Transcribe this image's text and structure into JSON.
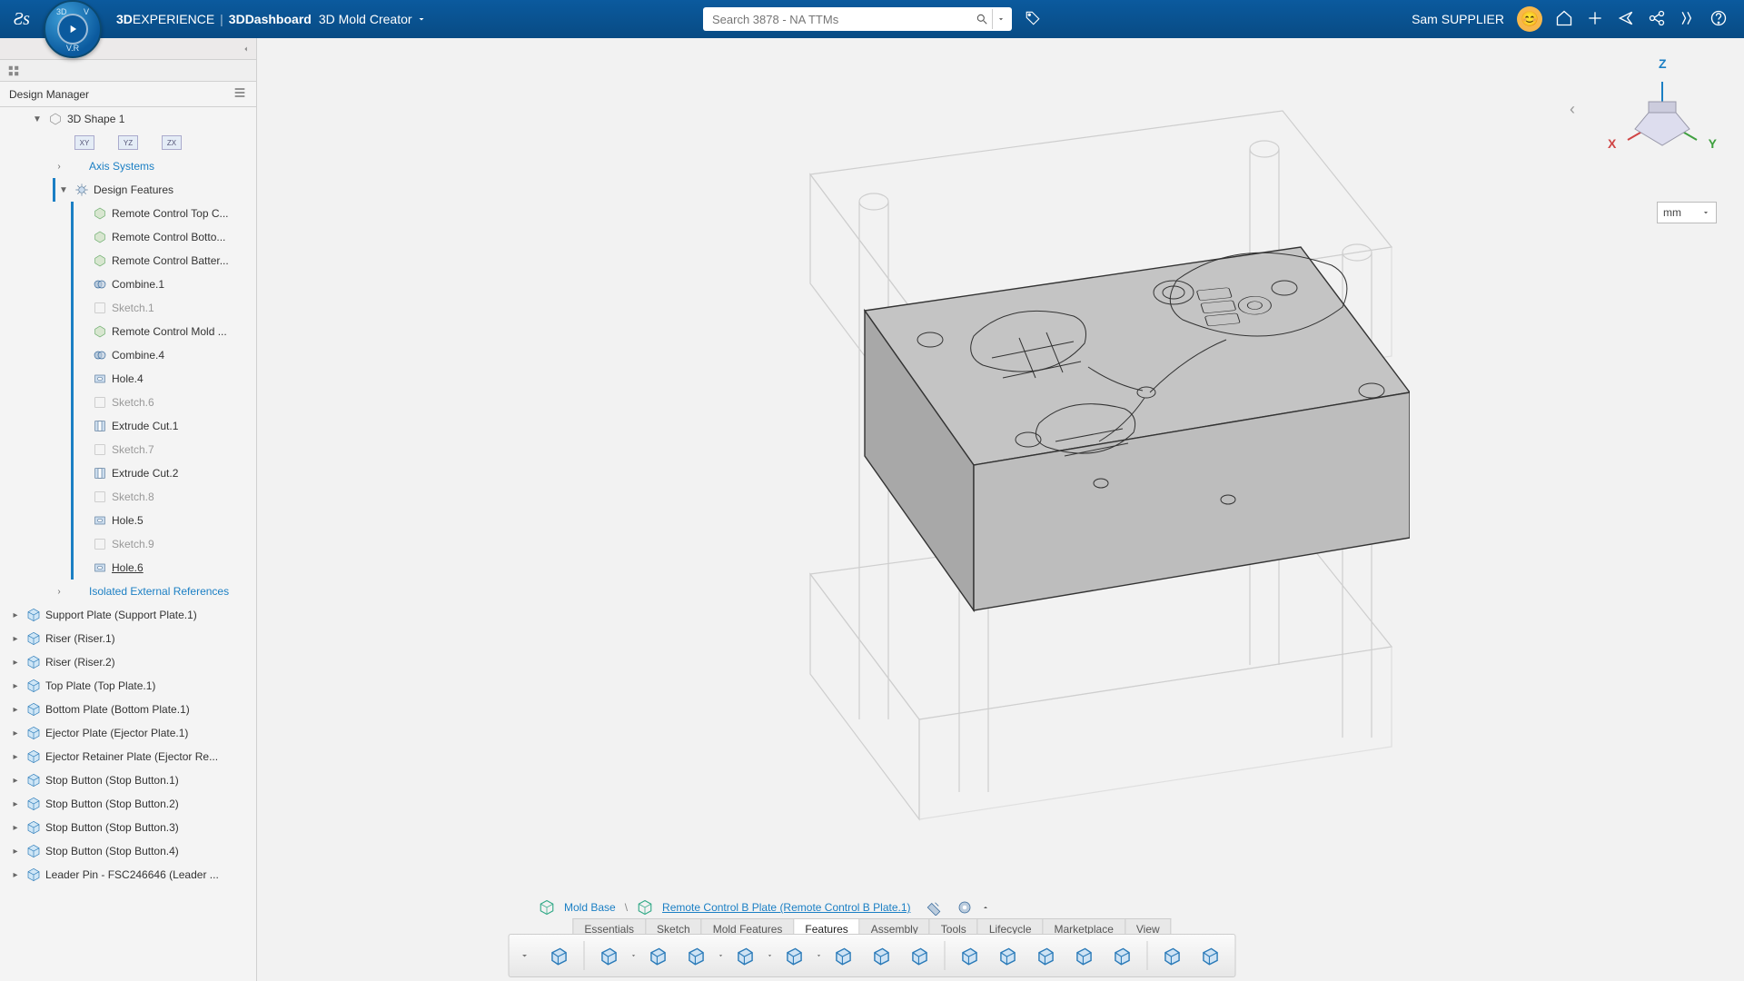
{
  "header": {
    "brand_a": "3D",
    "brand_b": "EXPERIENCE",
    "brand_c": "3DDashboard",
    "app": "3D Mold Creator",
    "search_placeholder": "Search 3878 - NA TTMs",
    "user": "Sam SUPPLIER",
    "avatar_emoji": "😊"
  },
  "panel": {
    "title": "Design Manager",
    "root": "3D Shape 1",
    "axis": "Axis Systems",
    "features_label": "Design Features",
    "features": [
      {
        "label": "Remote Control Top C...",
        "icon": "part",
        "muted": false
      },
      {
        "label": "Remote Control Botto...",
        "icon": "part",
        "muted": false
      },
      {
        "label": "Remote Control Batter...",
        "icon": "part",
        "muted": false
      },
      {
        "label": "Combine.1",
        "icon": "combine",
        "muted": false
      },
      {
        "label": "Sketch.1",
        "icon": "sketch",
        "muted": true
      },
      {
        "label": "Remote Control Mold ...",
        "icon": "part",
        "muted": false
      },
      {
        "label": "Combine.4",
        "icon": "combine",
        "muted": false
      },
      {
        "label": "Hole.4",
        "icon": "hole",
        "muted": false
      },
      {
        "label": "Sketch.6",
        "icon": "sketch",
        "muted": true
      },
      {
        "label": "Extrude Cut.1",
        "icon": "cut",
        "muted": false
      },
      {
        "label": "Sketch.7",
        "icon": "sketch",
        "muted": true
      },
      {
        "label": "Extrude Cut.2",
        "icon": "cut",
        "muted": false
      },
      {
        "label": "Sketch.8",
        "icon": "sketch",
        "muted": true
      },
      {
        "label": "Hole.5",
        "icon": "hole",
        "muted": false
      },
      {
        "label": "Sketch.9",
        "icon": "sketch",
        "muted": true
      },
      {
        "label": "Hole.6",
        "icon": "hole",
        "muted": false,
        "current": true
      }
    ],
    "iso_refs": "Isolated External References",
    "assembly": [
      "Support Plate (Support Plate.1)",
      "Riser (Riser.1)",
      "Riser (Riser.2)",
      "Top Plate (Top Plate.1)",
      "Bottom Plate (Bottom Plate.1)",
      "Ejector Plate (Ejector Plate.1)",
      "Ejector Retainer Plate (Ejector Re...",
      "Stop Button (Stop Button.1)",
      "Stop Button (Stop Button.2)",
      "Stop Button (Stop Button.3)",
      "Stop Button (Stop Button.4)",
      "Leader Pin - FSC246646 (Leader ..."
    ]
  },
  "viewport": {
    "unit": "mm",
    "axes": {
      "x": "X",
      "y": "Y",
      "z": "Z"
    }
  },
  "crumb": {
    "a": "Mold Base",
    "b": "Remote Control B Plate (Remote Control B Plate.1)"
  },
  "tabs": [
    "Essentials",
    "Sketch",
    "Mold Features",
    "Features",
    "Assembly",
    "Tools",
    "Lifecycle",
    "Marketplace",
    "View"
  ],
  "active_tab": "Features",
  "toolbar_icons": [
    "extrude",
    "pad-dd",
    "pad",
    "revolve",
    "revolve-dd",
    "sweep",
    "sweep-dd",
    "shell",
    "shell-dd",
    "cut",
    "draft",
    "draft2",
    "spline",
    "sweep2",
    "fillet",
    "fillet2",
    "thread",
    "hole",
    "combine"
  ]
}
